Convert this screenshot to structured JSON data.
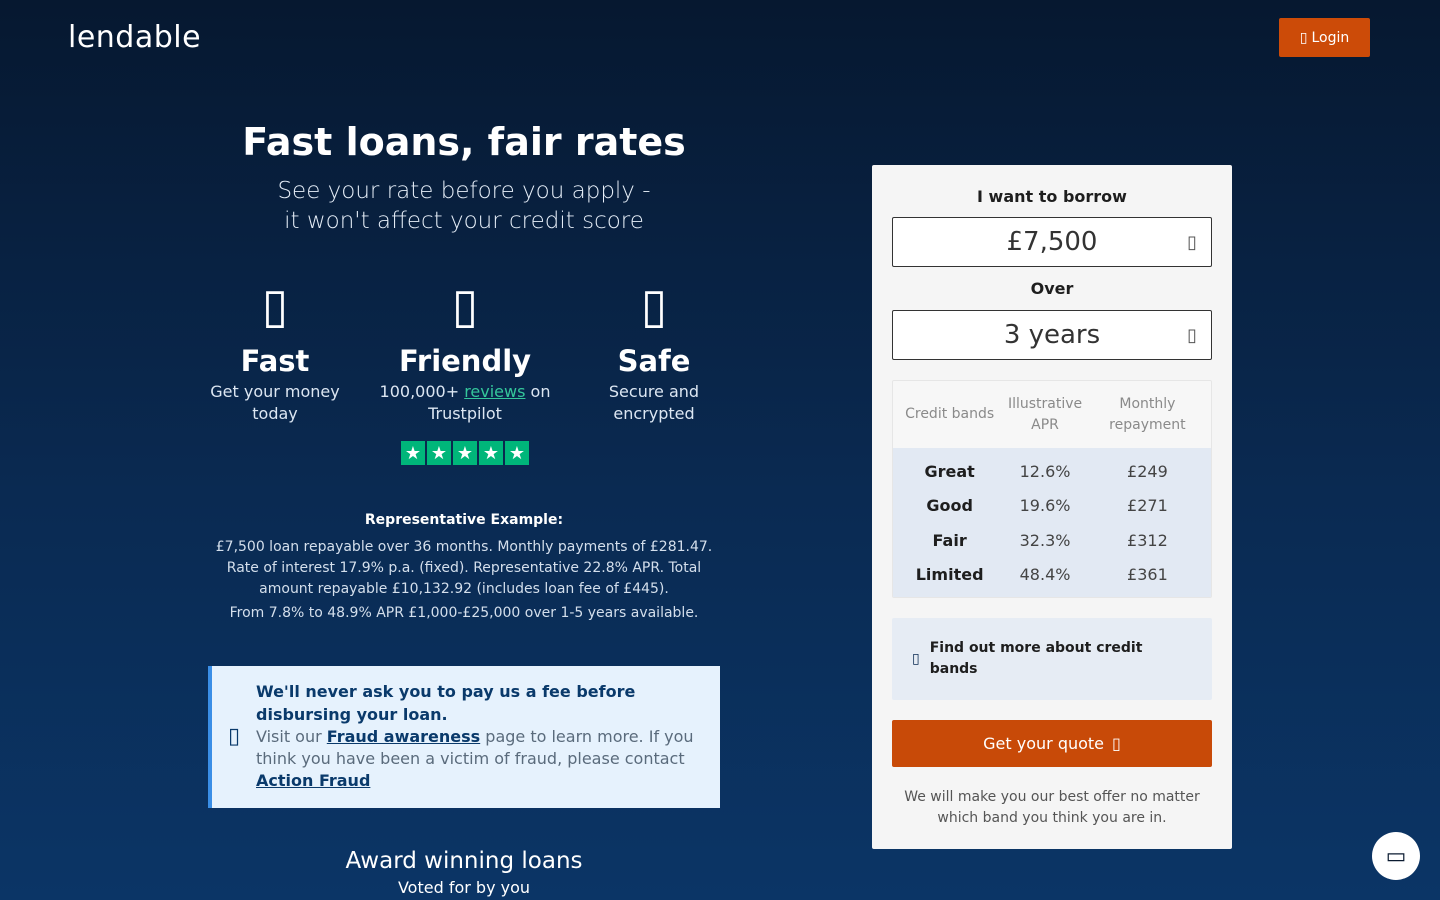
{
  "header": {
    "logo": "lendable",
    "login_icon": "lock-icon",
    "login_glyph": "▯",
    "login_label": "Login"
  },
  "hero": {
    "title": "Fast loans, fair rates",
    "subtitle_line1": "See your rate before you apply -",
    "subtitle_line2": "it won't affect your credit score"
  },
  "features": [
    {
      "icon": "rocket-icon",
      "glyph": "▯",
      "title": "Fast",
      "desc_line1": "Get your money",
      "desc_line2": "today"
    },
    {
      "icon": "smile-icon",
      "glyph": "▯",
      "title": "Friendly",
      "desc_prefix": "100,000+ ",
      "desc_link": "reviews",
      "desc_suffix": " on",
      "desc_line2": "Trustpilot"
    },
    {
      "icon": "shield-icon",
      "glyph": "▯",
      "title": "Safe",
      "desc_line1": "Secure and",
      "desc_line2": "encrypted"
    }
  ],
  "trustpilot": {
    "stars": 5,
    "color": "#00b67a"
  },
  "representative": {
    "title": "Representative Example:",
    "line1": "£7,500 loan repayable over 36 months. Monthly payments of £281.47.",
    "line2": "Rate of interest 17.9% p.a. (fixed). Representative 22.8% APR. Total",
    "line3": "amount repayable £10,132.92 (includes loan fee of £445).",
    "range": "From 7.8% to 48.9% APR £1,000-£25,000 over 1-5 years available."
  },
  "fraud": {
    "icon": "lock-icon",
    "glyph": "▯",
    "heading": "We'll never ask you to pay us a fee before disbursing your loan.",
    "text_pre": "Visit our ",
    "link1": "Fraud awareness",
    "text_mid": " page to learn more. If you think you have been a victim of fraud, please contact ",
    "link2": "Action Fraud"
  },
  "award": {
    "title": "Award winning loans",
    "subtitle": "Voted for by you"
  },
  "calculator": {
    "borrow_label": "I want to borrow",
    "amount": "£7,500",
    "over_label": "Over",
    "term": "3 years",
    "chevron_icon": "chevron-down-icon",
    "chevron_glyph": "▯",
    "headers": [
      "Credit bands",
      "Illustrative APR",
      "Monthly repayment"
    ],
    "bands": [
      {
        "name": "Great",
        "apr": "12.6%",
        "monthly": "£249"
      },
      {
        "name": "Good",
        "apr": "19.6%",
        "monthly": "£271"
      },
      {
        "name": "Fair",
        "apr": "32.3%",
        "monthly": "£312"
      },
      {
        "name": "Limited",
        "apr": "48.4%",
        "monthly": "£361"
      }
    ],
    "find_more_icon": "info-icon",
    "find_more_glyph": "▯",
    "find_more": "Find out more about credit bands",
    "quote_button": "Get your quote",
    "quote_icon": "arrow-right-icon",
    "quote_glyph": "▯",
    "footer": "We will make you our best offer no matter which band you think you are in."
  },
  "chat": {
    "icon": "chat-icon",
    "glyph": "▭"
  },
  "colors": {
    "accent": "#cc4b08",
    "navy": "#0a2a52",
    "trustpilot_green": "#00b67a",
    "link_green": "#34c79b"
  }
}
